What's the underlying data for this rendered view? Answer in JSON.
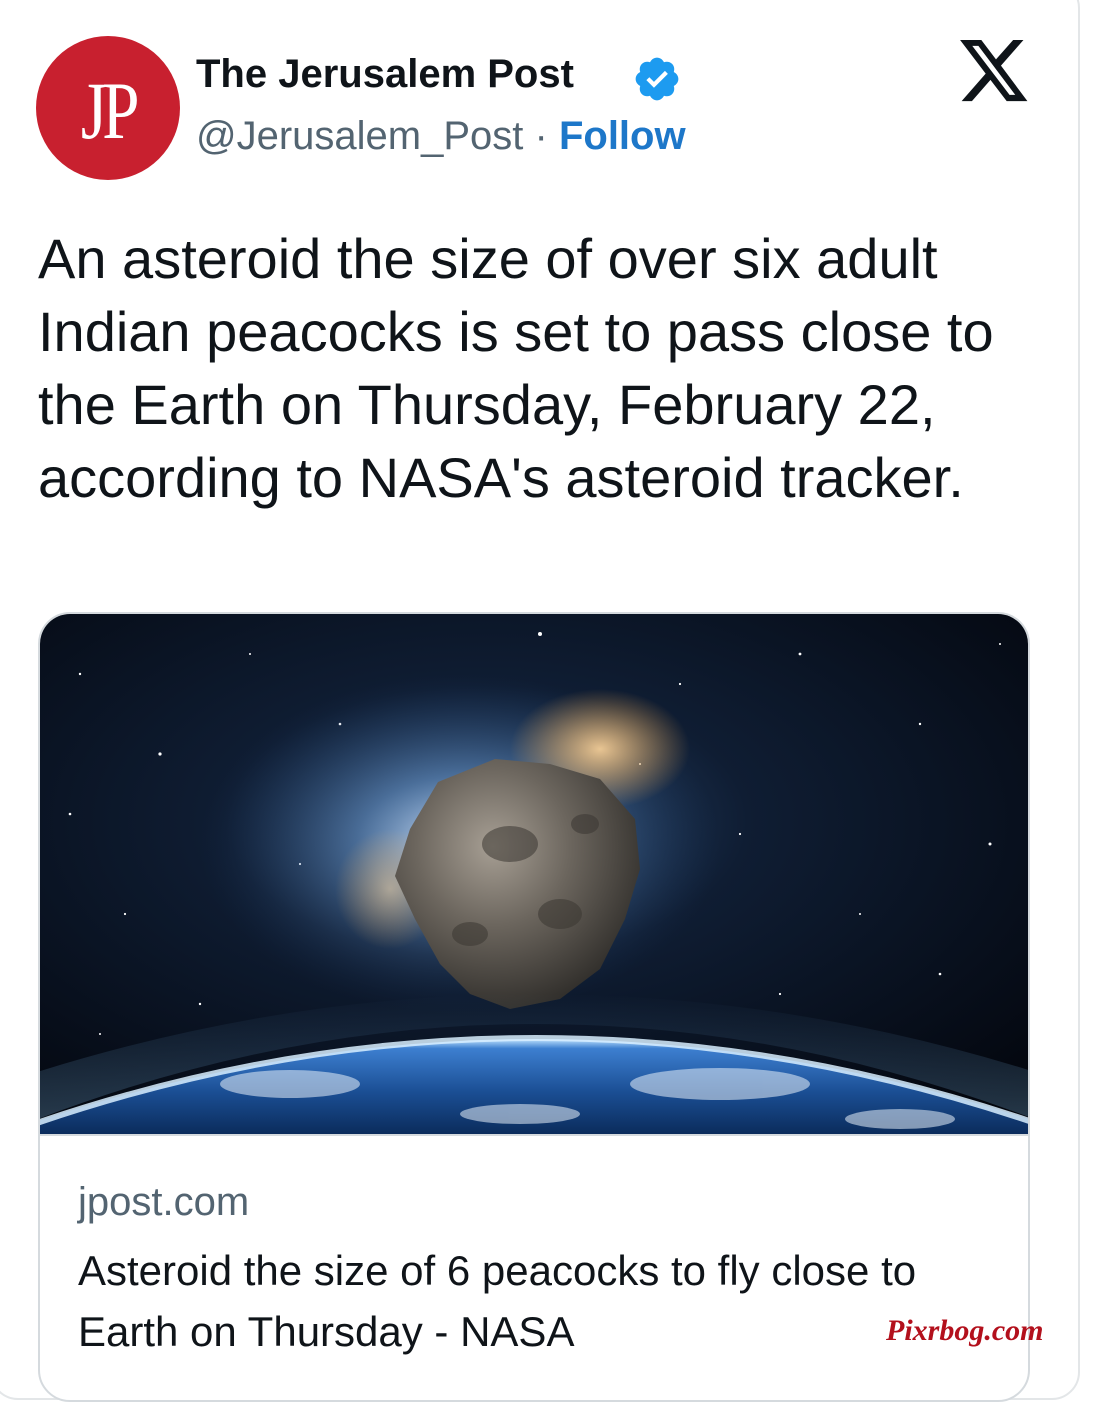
{
  "post": {
    "avatar_text": "JP",
    "account_name": "The Jerusalem Post",
    "handle": "@Jerusalem_Post",
    "separator": " · ",
    "follow_label": "Follow",
    "text": "An asteroid the size of over six adult Indian peacocks is set to pass close to the Earth on Thursday, February 22, according to NASA's asteroid tracker."
  },
  "link_card": {
    "domain": "jpost.com",
    "title": "Asteroid the size of 6 peacocks to fly close to Earth on Thursday - NASA"
  },
  "watermark": "Pixrbog.com",
  "icons": {
    "verified": "verified-badge-icon",
    "platform": "x-logo-icon"
  },
  "colors": {
    "avatar_bg": "#c8202f",
    "follow": "#1d77c9",
    "verified": "#1d9bf0",
    "secondary_text": "#536471",
    "watermark": "#b3101c"
  }
}
